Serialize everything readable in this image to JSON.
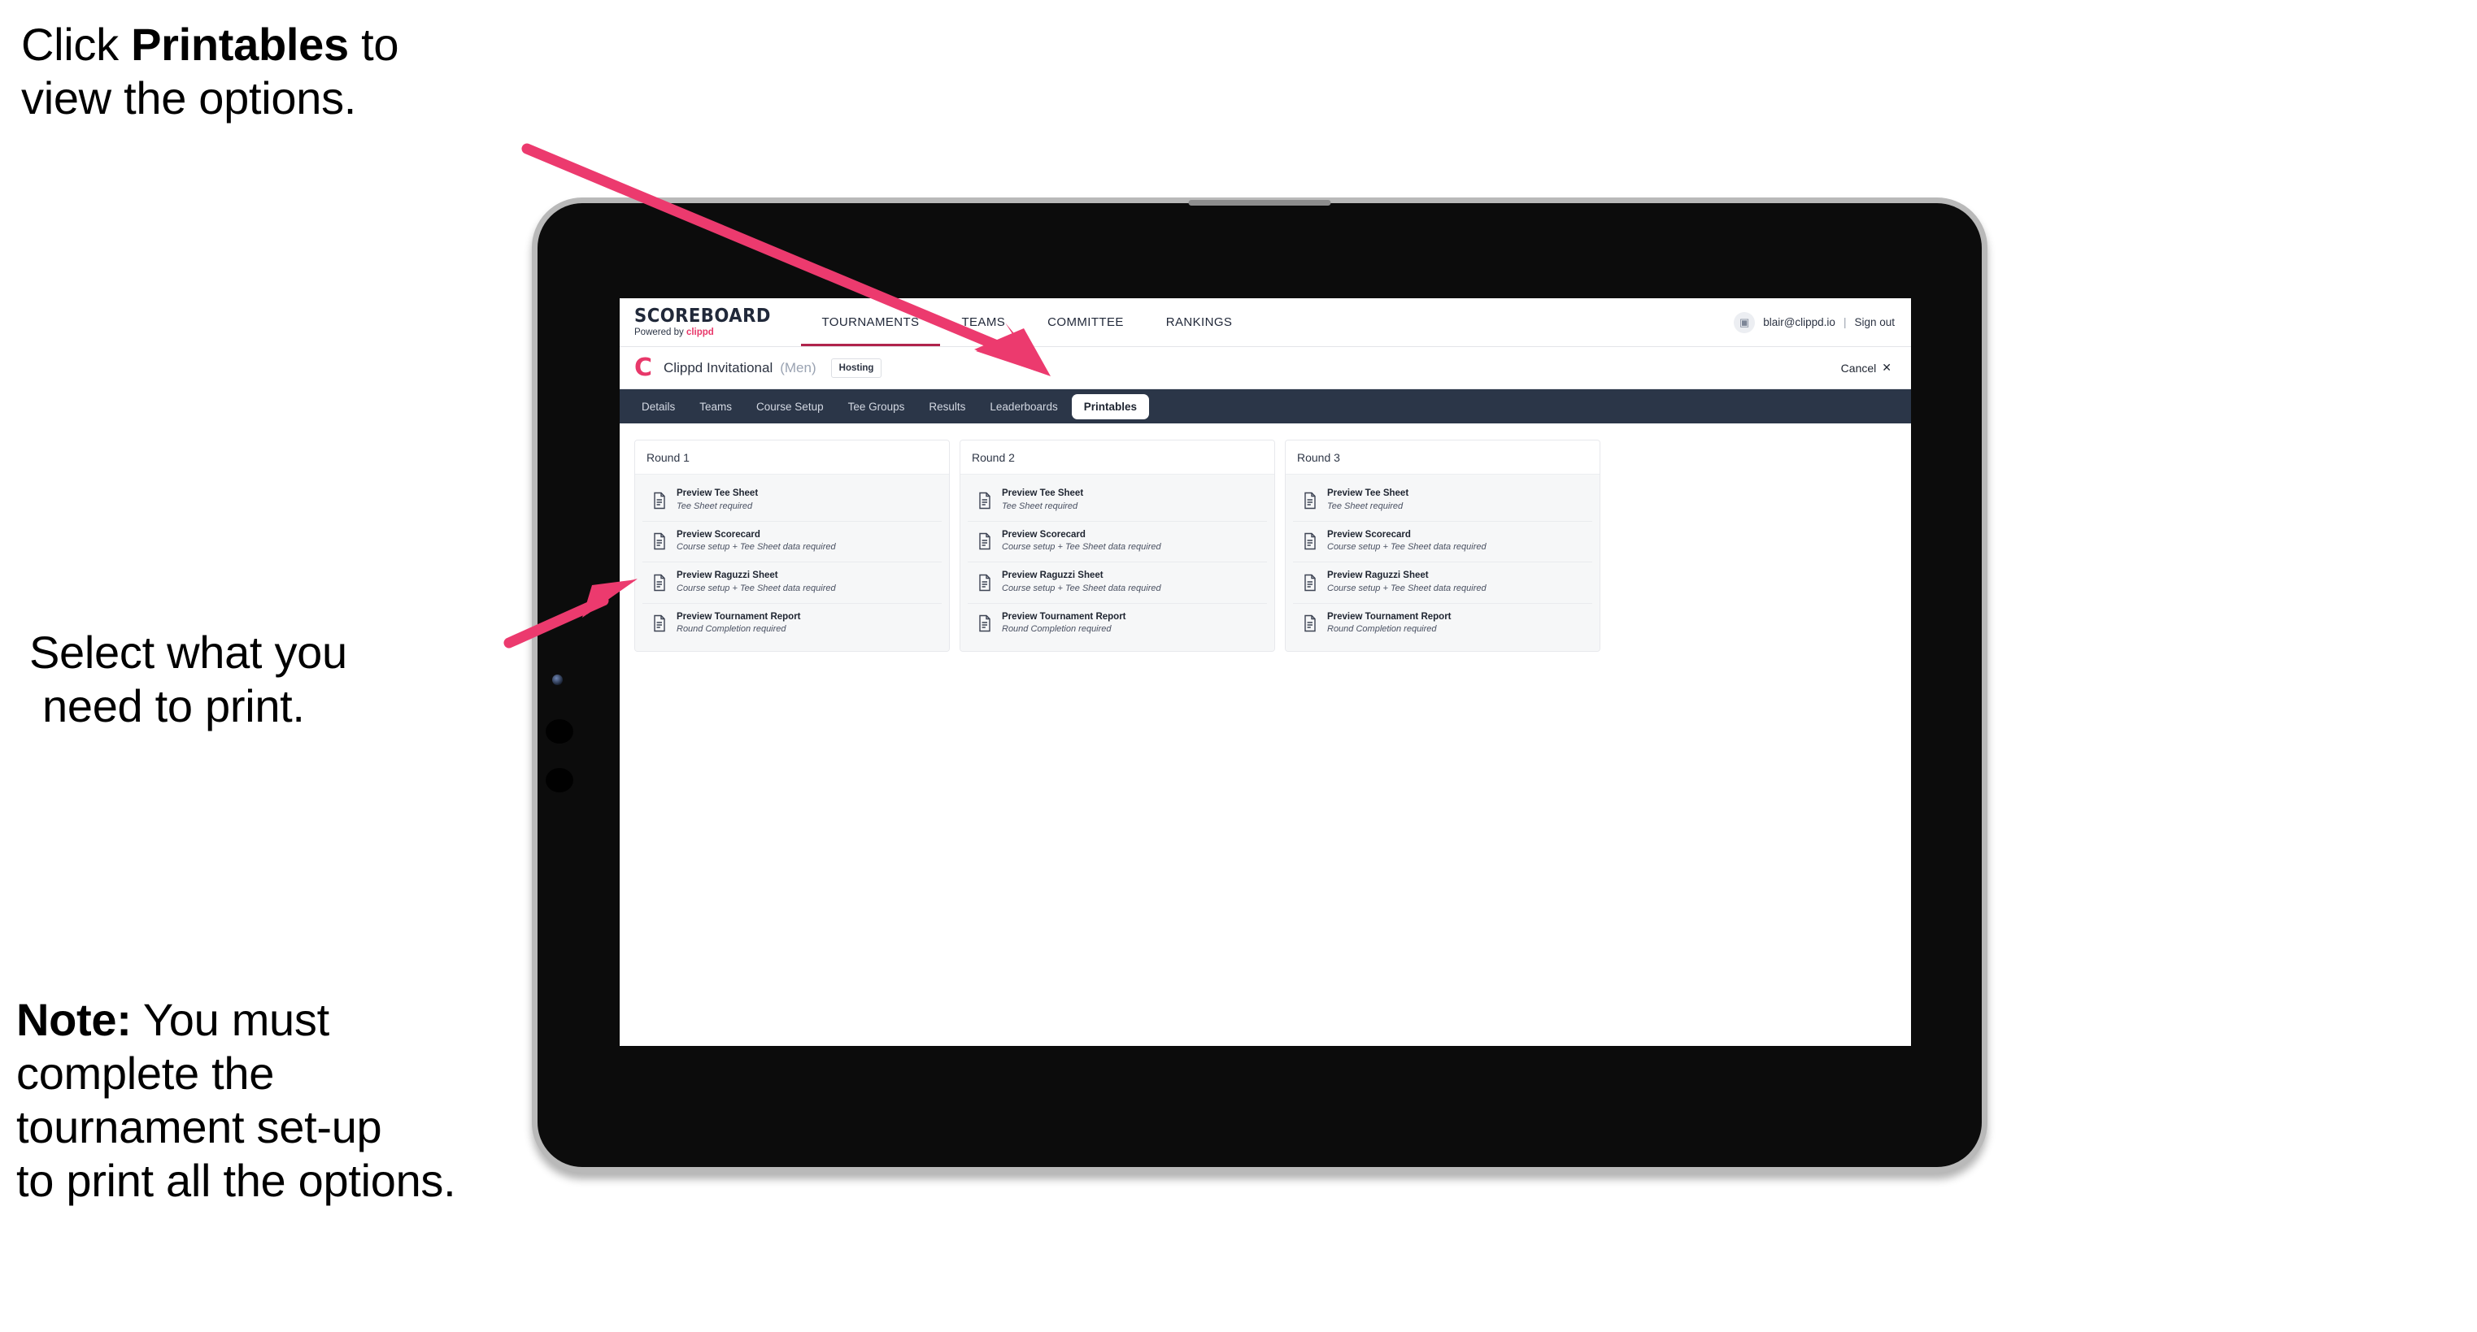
{
  "annotations": {
    "top": {
      "lines": [
        {
          "pre": "Click ",
          "bold": "Printables",
          "post": " to"
        },
        {
          "pre": "view the options.",
          "bold": "",
          "post": ""
        }
      ]
    },
    "middle": {
      "line1": "Select what you",
      "line2": "need to print."
    },
    "note": {
      "label": "Note:",
      "line1_rest": " You must",
      "line2": "complete the",
      "line3": "tournament set-up",
      "line4": "to print all the options."
    }
  },
  "app": {
    "brand": {
      "title": "SCOREBOARD",
      "powered_prefix": "Powered by ",
      "powered_brand": "clippd"
    },
    "mainnav": [
      {
        "label": "TOURNAMENTS",
        "active": true
      },
      {
        "label": "TEAMS",
        "active": false
      },
      {
        "label": "COMMITTEE",
        "active": false
      },
      {
        "label": "RANKINGS",
        "active": false
      }
    ],
    "user": {
      "avatar_glyph": "▣",
      "email": "blair@clippd.io",
      "separator": "|",
      "signout": "Sign out"
    },
    "tournament": {
      "logo_letter": "C",
      "name": "Clippd Invitational",
      "gender": "(Men)",
      "status_badge": "Hosting",
      "cancel_label": "Cancel",
      "cancel_icon": "✕"
    },
    "tabs": [
      {
        "label": "Details",
        "active": false
      },
      {
        "label": "Teams",
        "active": false
      },
      {
        "label": "Course Setup",
        "active": false
      },
      {
        "label": "Tee Groups",
        "active": false
      },
      {
        "label": "Results",
        "active": false
      },
      {
        "label": "Leaderboards",
        "active": false
      },
      {
        "label": "Printables",
        "active": true
      }
    ],
    "rounds": [
      {
        "heading": "Round 1",
        "items": [
          {
            "title": "Preview Tee Sheet",
            "subtitle": "Tee Sheet required"
          },
          {
            "title": "Preview Scorecard",
            "subtitle": "Course setup + Tee Sheet data required"
          },
          {
            "title": "Preview Raguzzi Sheet",
            "subtitle": "Course setup + Tee Sheet data required"
          },
          {
            "title": "Preview Tournament Report",
            "subtitle": "Round Completion required"
          }
        ]
      },
      {
        "heading": "Round 2",
        "items": [
          {
            "title": "Preview Tee Sheet",
            "subtitle": "Tee Sheet required"
          },
          {
            "title": "Preview Scorecard",
            "subtitle": "Course setup + Tee Sheet data required"
          },
          {
            "title": "Preview Raguzzi Sheet",
            "subtitle": "Course setup + Tee Sheet data required"
          },
          {
            "title": "Preview Tournament Report",
            "subtitle": "Round Completion required"
          }
        ]
      },
      {
        "heading": "Round 3",
        "items": [
          {
            "title": "Preview Tee Sheet",
            "subtitle": "Tee Sheet required"
          },
          {
            "title": "Preview Scorecard",
            "subtitle": "Course setup + Tee Sheet data required"
          },
          {
            "title": "Preview Raguzzi Sheet",
            "subtitle": "Course setup + Tee Sheet data required"
          },
          {
            "title": "Preview Tournament Report",
            "subtitle": "Round Completion required"
          }
        ]
      }
    ]
  },
  "colors": {
    "accent_pink": "#e8386a",
    "arrow_pink": "#ec3a6e",
    "tabbar_dark": "#2b3648",
    "nav_underline": "#b0234c",
    "panel_bg": "#f6f7f8",
    "device_bezel": "#b9b9b9",
    "device_screen": "#0c0c0c"
  }
}
